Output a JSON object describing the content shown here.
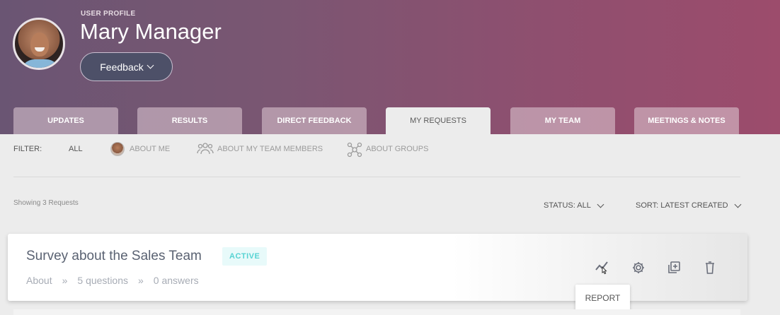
{
  "profile": {
    "subtitle": "USER PROFILE",
    "name": "Mary Manager",
    "feedback_label": "Feedback"
  },
  "tabs": [
    {
      "label": "UPDATES",
      "active": false
    },
    {
      "label": "RESULTS",
      "active": false
    },
    {
      "label": "DIRECT FEEDBACK",
      "active": false
    },
    {
      "label": "MY REQUESTS",
      "active": true
    },
    {
      "label": "MY TEAM",
      "active": false
    },
    {
      "label": "MEETINGS & NOTES",
      "active": false
    }
  ],
  "filter": {
    "label": "FILTER:",
    "all": "ALL",
    "about_me": "ABOUT ME",
    "about_team": "ABOUT MY TEAM MEMBERS",
    "about_groups": "ABOUT GROUPS"
  },
  "list": {
    "showing": "Showing 3 Requests",
    "status_label": "STATUS: ALL",
    "sort_label": "SORT: LATEST CREATED"
  },
  "request": {
    "title": "Survey about the Sales Team",
    "status": "ACTIVE",
    "about": "About",
    "sep": "»",
    "questions": "5 questions",
    "answers": "0 answers",
    "tooltip": "REPORT"
  },
  "colors": {
    "accent": "#56d3d3",
    "header_start": "#6a5573",
    "header_end": "#9c4c6c"
  }
}
